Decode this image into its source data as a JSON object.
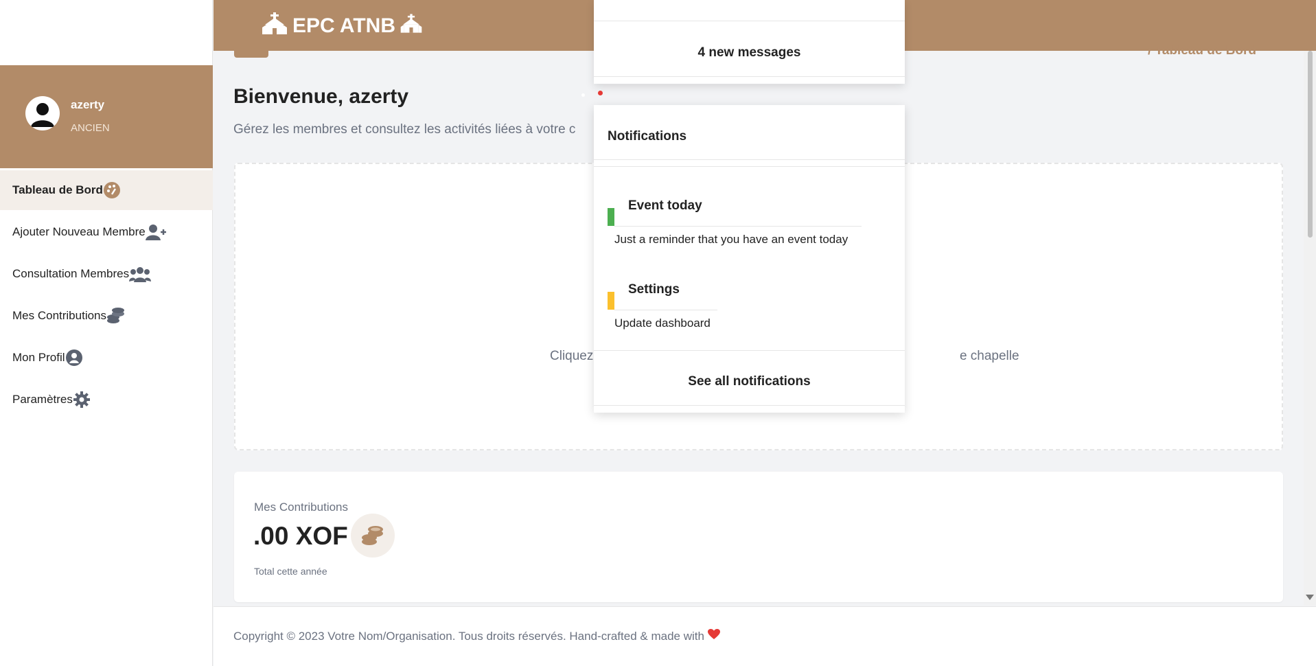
{
  "header": {
    "brand": "EPC ATNB",
    "breadcrumb": "/ Tableau de Bord"
  },
  "user": {
    "name": "azerty",
    "role": "ANCIEN"
  },
  "sidebar": {
    "items": [
      {
        "label": "Tableau de Bord",
        "icon": "dashboard-icon"
      },
      {
        "label": "Ajouter Nouveau Membre",
        "icon": "user-plus-icon"
      },
      {
        "label": "Consultation Membres",
        "icon": "users-icon"
      },
      {
        "label": "Mes Contributions",
        "icon": "coins-icon"
      },
      {
        "label": "Mon Profil",
        "icon": "user-circle-icon"
      },
      {
        "label": "Paramètres",
        "icon": "gear-icon"
      }
    ]
  },
  "main": {
    "title": "Bienvenue, azerty",
    "subtitle": "Gérez les membres et consultez les activités liées à votre c",
    "empty_text_left": "Cliquez",
    "empty_text_right": "e chapelle"
  },
  "contributions": {
    "label": "Mes Contributions",
    "value": ".00 XOF",
    "footnote": "Total cette année"
  },
  "messages": {
    "link": "4 new messages"
  },
  "notifications": {
    "header": "Notifications",
    "items": [
      {
        "title": "Event today",
        "text": "Just a reminder that you have an event today",
        "color": "#4caf50"
      },
      {
        "title": "Settings",
        "text": "Update dashboard",
        "color": "#fbc02d"
      }
    ],
    "see_all": "See all notifications"
  },
  "footer": {
    "text": "Copyright © 2023 Votre Nom/Organisation. Tous droits réservés. Hand-crafted & made with"
  },
  "colors": {
    "brand": "#b28b68",
    "heart": "#e53935"
  }
}
